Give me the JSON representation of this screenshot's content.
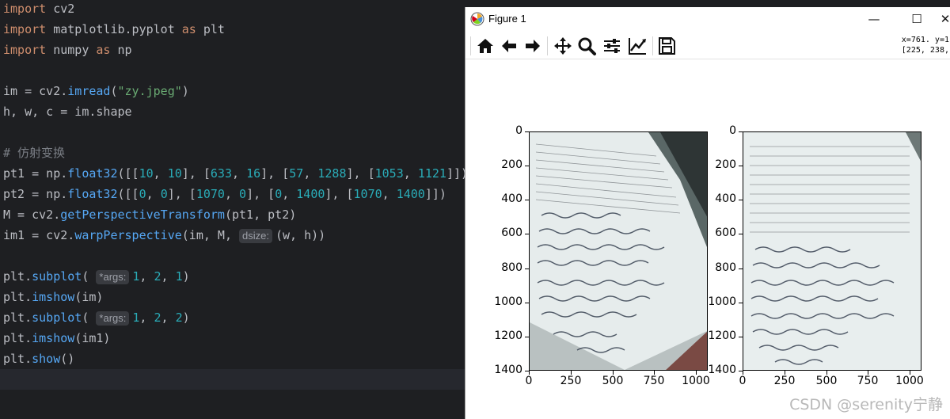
{
  "editor": {
    "code_lines": [
      [
        {
          "t": "import",
          "c": "kw"
        },
        {
          "t": " cv2"
        }
      ],
      [
        {
          "t": "import",
          "c": "kw"
        },
        {
          "t": " matplotlib.pyplot "
        },
        {
          "t": "as",
          "c": "kw"
        },
        {
          "t": " plt"
        }
      ],
      [
        {
          "t": "import",
          "c": "kw"
        },
        {
          "t": " numpy "
        },
        {
          "t": "as",
          "c": "kw"
        },
        {
          "t": " np"
        }
      ],
      [],
      [
        {
          "t": "im = cv2."
        },
        {
          "t": "imread",
          "c": "fn"
        },
        {
          "t": "("
        },
        {
          "t": "\"zy.jpeg\"",
          "c": "str"
        },
        {
          "t": ")"
        }
      ],
      [
        {
          "t": "h, w, c = im.shape"
        }
      ],
      [],
      [
        {
          "t": "# 仿射变换",
          "c": "cmt"
        }
      ],
      [
        {
          "t": "pt1 = np."
        },
        {
          "t": "float32",
          "c": "fn"
        },
        {
          "t": "([["
        },
        {
          "t": "10",
          "c": "num"
        },
        {
          "t": ", "
        },
        {
          "t": "10",
          "c": "num"
        },
        {
          "t": "], ["
        },
        {
          "t": "633",
          "c": "num"
        },
        {
          "t": ", "
        },
        {
          "t": "16",
          "c": "num"
        },
        {
          "t": "], ["
        },
        {
          "t": "57",
          "c": "num"
        },
        {
          "t": ", "
        },
        {
          "t": "1288",
          "c": "num"
        },
        {
          "t": "], ["
        },
        {
          "t": "1053",
          "c": "num"
        },
        {
          "t": ", "
        },
        {
          "t": "1121",
          "c": "num"
        },
        {
          "t": "]])"
        }
      ],
      [
        {
          "t": "pt2 = np."
        },
        {
          "t": "float32",
          "c": "fn"
        },
        {
          "t": "([["
        },
        {
          "t": "0",
          "c": "num"
        },
        {
          "t": ", "
        },
        {
          "t": "0",
          "c": "num"
        },
        {
          "t": "], ["
        },
        {
          "t": "1070",
          "c": "num"
        },
        {
          "t": ", "
        },
        {
          "t": "0",
          "c": "num"
        },
        {
          "t": "], ["
        },
        {
          "t": "0",
          "c": "num"
        },
        {
          "t": ", "
        },
        {
          "t": "1400",
          "c": "num"
        },
        {
          "t": "], ["
        },
        {
          "t": "1070",
          "c": "num"
        },
        {
          "t": ", "
        },
        {
          "t": "1400",
          "c": "num"
        },
        {
          "t": "]])"
        }
      ],
      [
        {
          "t": "M = cv2."
        },
        {
          "t": "getPerspectiveTransform",
          "c": "fn"
        },
        {
          "t": "(pt1, pt2)"
        }
      ],
      [
        {
          "t": "im1 = cv2."
        },
        {
          "t": "warpPerspective",
          "c": "fn"
        },
        {
          "t": "(im, M, "
        },
        {
          "t": "dsize:",
          "c": "hint"
        },
        {
          "t": "(w, h))"
        }
      ],
      [],
      [
        {
          "t": "plt."
        },
        {
          "t": "subplot",
          "c": "fn"
        },
        {
          "t": "( "
        },
        {
          "t": "*args:",
          "c": "hint"
        },
        {
          "t": "1",
          "c": "num"
        },
        {
          "t": ", "
        },
        {
          "t": "2",
          "c": "num"
        },
        {
          "t": ", "
        },
        {
          "t": "1",
          "c": "num"
        },
        {
          "t": ")"
        }
      ],
      [
        {
          "t": "plt."
        },
        {
          "t": "imshow",
          "c": "fn"
        },
        {
          "t": "(im)"
        }
      ],
      [
        {
          "t": "plt."
        },
        {
          "t": "subplot",
          "c": "fn"
        },
        {
          "t": "( "
        },
        {
          "t": "*args:",
          "c": "hint"
        },
        {
          "t": "1",
          "c": "num"
        },
        {
          "t": ", "
        },
        {
          "t": "2",
          "c": "num"
        },
        {
          "t": ", "
        },
        {
          "t": "2",
          "c": "num"
        },
        {
          "t": ")"
        }
      ],
      [
        {
          "t": "plt."
        },
        {
          "t": "imshow",
          "c": "fn"
        },
        {
          "t": "(im1)"
        }
      ],
      [
        {
          "t": "plt."
        },
        {
          "t": "show",
          "c": "fn"
        },
        {
          "t": "()"
        }
      ]
    ]
  },
  "figure": {
    "window_title": "Figure 1",
    "minimize_glyph": "—",
    "maximize_glyph": "☐",
    "close_glyph": "✕",
    "coord_readout": "x=761. y=1\n[225, 238,",
    "toolbar_icons": [
      "home-icon",
      "back-arrow-icon",
      "forward-arrow-icon",
      "pan-icon",
      "zoom-icon",
      "configure-subplots-icon",
      "edit-axes-icon",
      "save-icon"
    ],
    "watermark": "CSDN @serenity宁静"
  },
  "chart_data": [
    {
      "type": "image",
      "title": "",
      "ylim": [
        1400,
        0
      ],
      "xlim": [
        0,
        1070
      ],
      "y_ticks": [
        "0",
        "200",
        "400",
        "600",
        "800",
        "1000",
        "1200",
        "1400"
      ],
      "x_ticks": [
        "0",
        "250",
        "500",
        "750",
        "1000"
      ]
    },
    {
      "type": "image",
      "title": "",
      "ylim": [
        1400,
        0
      ],
      "xlim": [
        0,
        1070
      ],
      "y_ticks": [
        "0",
        "200",
        "400",
        "600",
        "800",
        "1000",
        "1200",
        "1400"
      ],
      "x_ticks": [
        "0",
        "250",
        "500",
        "750",
        "1000"
      ]
    }
  ],
  "colors": {
    "editor_bg": "#1e1f22",
    "keyword": "#cf8e6d",
    "function": "#56a8f5",
    "string": "#6aab73",
    "number": "#2aacb8",
    "comment": "#7a7e85"
  }
}
